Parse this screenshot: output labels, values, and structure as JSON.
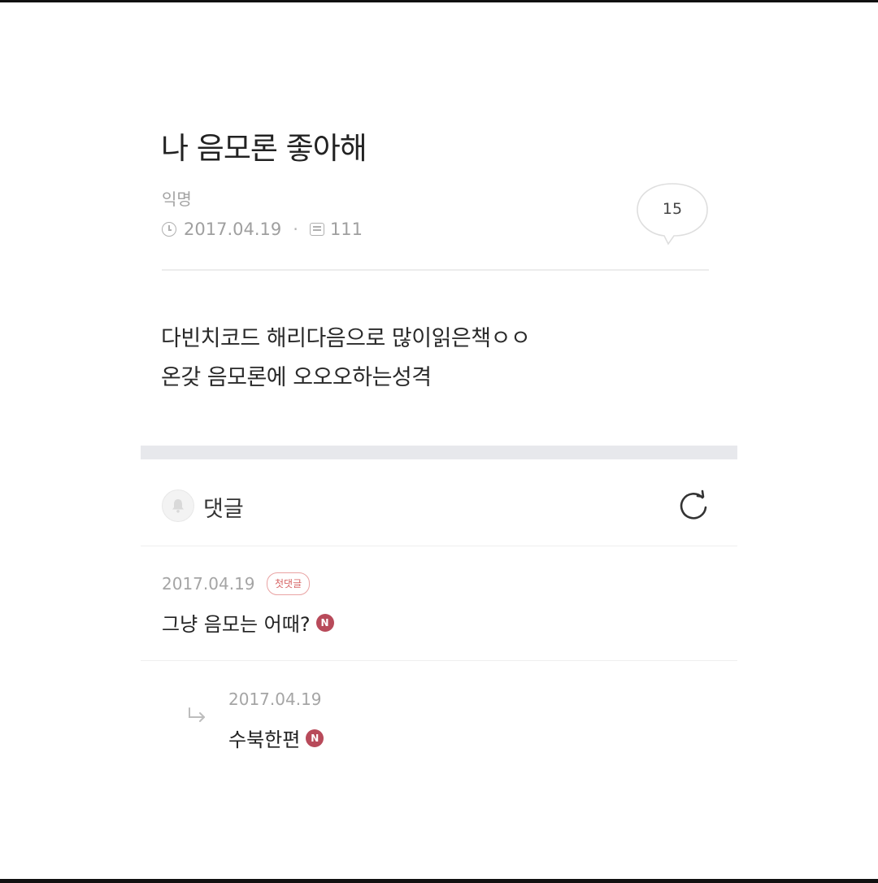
{
  "post": {
    "title": "나 음모론 좋아해",
    "author": "익명",
    "date": "2017.04.19",
    "separator": "·",
    "views": "111",
    "comment_count": "15",
    "body_lines": [
      "다빈치코드 해리다음으로 많이읽은책ㅇㅇ",
      "온갖 음모론에 오오오하는성격"
    ]
  },
  "comments_section": {
    "label": "댓글"
  },
  "comments": [
    {
      "date": "2017.04.19",
      "badge": "첫댓글",
      "text": "그냥 음모는 어때?",
      "new_badge": "N"
    },
    {
      "date": "2017.04.19",
      "text": "수북한편",
      "new_badge": "N",
      "is_reply": true
    }
  ],
  "icons": {
    "clock": "clock-icon",
    "views": "views-icon",
    "comment_bubble": "speech-bubble-icon",
    "bell": "bell-icon",
    "refresh": "refresh-icon",
    "reply": "reply-arrow-icon"
  },
  "colors": {
    "new_badge": "#b84a5a",
    "first_comment_badge": "#d76666",
    "section_bar": "#e7e8ec"
  }
}
